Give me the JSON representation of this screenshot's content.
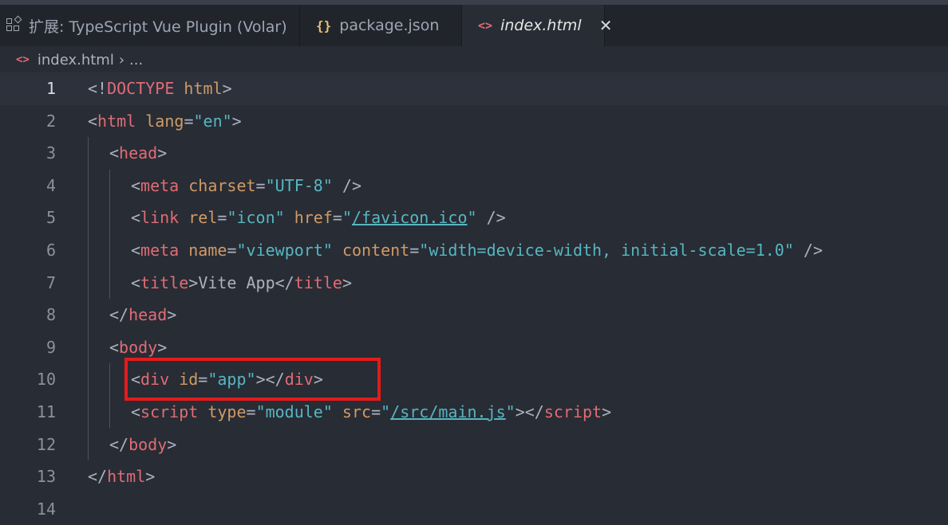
{
  "tabs": [
    {
      "label": "扩展: TypeScript Vue Plugin (Volar)",
      "icon": "extensions-icon"
    },
    {
      "label": "package.json",
      "icon": "json-braces-icon"
    },
    {
      "label": "index.html",
      "icon": "html-brackets-icon",
      "active": true
    }
  ],
  "breadcrumb": {
    "file": "index.html",
    "rest": "..."
  },
  "lines": [
    {
      "n": "1",
      "current": true
    },
    {
      "n": "2"
    },
    {
      "n": "3"
    },
    {
      "n": "4"
    },
    {
      "n": "5"
    },
    {
      "n": "6"
    },
    {
      "n": "7"
    },
    {
      "n": "8"
    },
    {
      "n": "9"
    },
    {
      "n": "10"
    },
    {
      "n": "11"
    },
    {
      "n": "12"
    },
    {
      "n": "13"
    },
    {
      "n": "14"
    }
  ],
  "code": {
    "l1": {
      "a": "<!",
      "b": "DOCTYPE",
      "c": " html",
      "d": ">"
    },
    "l2": {
      "a": "<",
      "b": "html",
      "c": " lang",
      "d": "=",
      "e": "\"en\"",
      "f": ">"
    },
    "l3": {
      "a": "<",
      "b": "head",
      "c": ">"
    },
    "l4": {
      "a": "<",
      "b": "meta",
      "c": " charset",
      "d": "=",
      "e": "\"UTF-8\"",
      "f": " />"
    },
    "l5": {
      "a": "<",
      "b": "link",
      "c": " rel",
      "d": "=",
      "e": "\"icon\"",
      "f": " href",
      "g": "=",
      "h": "\"",
      "i": "/favicon.ico",
      "j": "\"",
      "k": " />"
    },
    "l6": {
      "a": "<",
      "b": "meta",
      "c": " name",
      "d": "=",
      "e": "\"viewport\"",
      "f": " content",
      "g": "=",
      "h": "\"width=device-width, initial-scale=1.0\"",
      "i": " />"
    },
    "l7": {
      "a": "<",
      "b": "title",
      "c": ">",
      "d": "Vite App",
      "e": "</",
      "f": "title",
      "g": ">"
    },
    "l8": {
      "a": "</",
      "b": "head",
      "c": ">"
    },
    "l9": {
      "a": "<",
      "b": "body",
      "c": ">"
    },
    "l10": {
      "a": "<",
      "b": "div",
      "c": " id",
      "d": "=",
      "e": "\"app\"",
      "f": "></",
      "g": "div",
      "h": ">"
    },
    "l11": {
      "a": "<",
      "b": "script",
      "c": " type",
      "d": "=",
      "e": "\"module\"",
      "f": " src",
      "g": "=",
      "h": "\"",
      "i": "/src/main.js",
      "j": "\"",
      "k": "></",
      "l": "script",
      "m": ">"
    },
    "l12": {
      "a": "</",
      "b": "body",
      "c": ">"
    },
    "l13": {
      "a": "</",
      "b": "html",
      "c": ">"
    }
  },
  "colors": {
    "highlight_box": "#e41b1b",
    "background": "#282c34"
  }
}
